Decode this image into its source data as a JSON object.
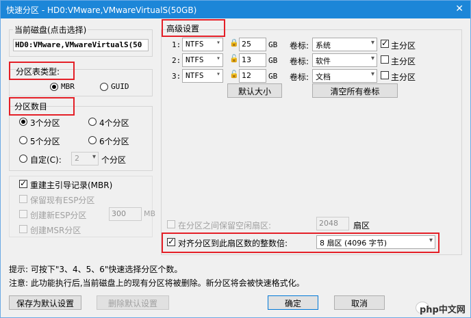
{
  "window": {
    "title": "快速分区 - HD0:VMware,VMwareVirtualS(50GB)",
    "close_glyph": "✕"
  },
  "disk": {
    "group_label": "当前磁盘(点击选择)",
    "selected": "HD0:VMware,VMwareVirtualS(50"
  },
  "partition_table": {
    "label": "分区表类型:",
    "options": [
      "MBR",
      "GUID"
    ],
    "selected": "MBR"
  },
  "partition_count": {
    "label": "分区数目",
    "options": [
      "3个分区",
      "4个分区",
      "5个分区",
      "6个分区",
      "自定(C):"
    ],
    "selected": "3个分区",
    "custom_value": "2",
    "custom_suffix": "个分区"
  },
  "options": {
    "rebuild_mbr": "重建主引导记录(MBR)",
    "keep_esp": "保留现有ESP分区",
    "create_esp": "创建新ESP分区",
    "esp_size": "300",
    "esp_unit": "MB",
    "create_msr": "创建MSR分区"
  },
  "advanced": {
    "label": "高级设置",
    "gb_unit": "GB",
    "vol_label": "卷标:",
    "primary_label": "主分区",
    "rows": [
      {
        "index": "1:",
        "fs": "NTFS",
        "size": "25",
        "volume": "系统",
        "primary": true
      },
      {
        "index": "2:",
        "fs": "NTFS",
        "size": "13",
        "volume": "软件",
        "primary": false
      },
      {
        "index": "3:",
        "fs": "NTFS",
        "size": "12",
        "volume": "文档",
        "primary": false
      }
    ],
    "default_size_button": "默认大小",
    "clear_labels_button": "清空所有卷标"
  },
  "reserve": {
    "label": "在分区之间保留空闲扇区:",
    "value": "2048",
    "unit": "扇区"
  },
  "align": {
    "label": "对齐分区到此扇区数的整数倍:",
    "value": "8 扇区 (4096 字节)",
    "checked": true
  },
  "hints": {
    "line1": "提示: 可按下\"3、4、5、6\"快速选择分区个数。",
    "line2": "注意: 此功能执行后,当前磁盘上的现有分区将被删除。新分区将会被快速格式化。"
  },
  "buttons": {
    "save_default": "保存为默认设置",
    "delete_default": "删除默认设置",
    "ok": "确定",
    "cancel": "取消"
  },
  "watermark": "php中文网"
}
